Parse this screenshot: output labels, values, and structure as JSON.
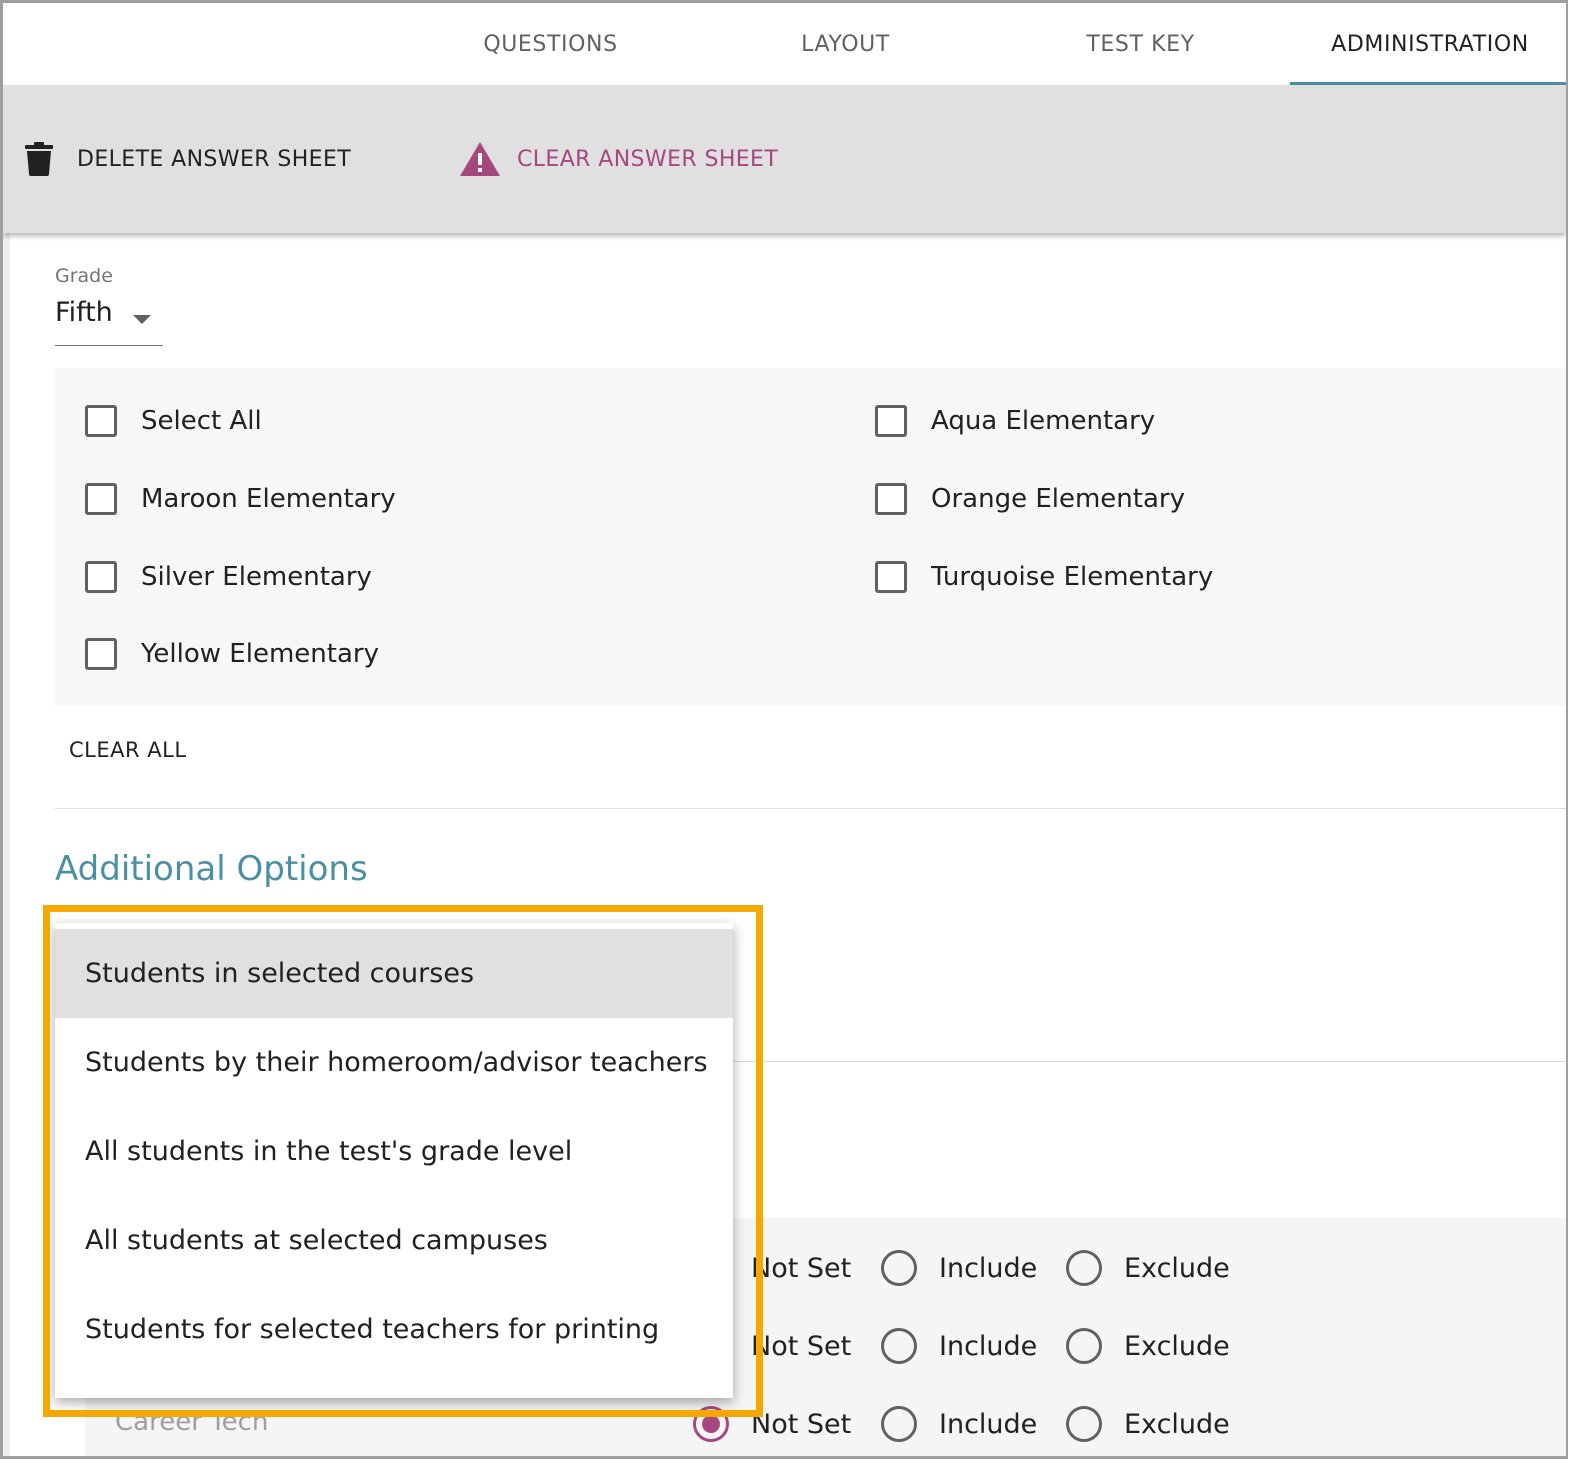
{
  "tabs": [
    "QUESTIONS",
    "LAYOUT",
    "TEST KEY",
    "ADMINISTRATION"
  ],
  "active_tab": "ADMINISTRATION",
  "toolbar": {
    "delete_label": "DELETE ANSWER SHEET",
    "clear_label": "CLEAR ANSWER SHEET",
    "warning_color": "#a64780"
  },
  "grade": {
    "label": "Grade",
    "value": "Fifth"
  },
  "campuses": [
    "Select All",
    "Aqua Elementary",
    "Maroon Elementary",
    "Orange Elementary",
    "Silver Elementary",
    "Turquoise Elementary",
    "Yellow Elementary"
  ],
  "clear_all_label": "CLEAR ALL",
  "additional_options_title": "Additional Options",
  "student_selection_menu": {
    "options": [
      "Students in selected courses",
      "Students by their homeroom/advisor teachers",
      "All students in the test's grade level",
      "All students at selected campuses",
      "Students for selected teachers for printing"
    ],
    "selected": "Students in selected courses"
  },
  "filters": {
    "rows": [
      {
        "label": "",
        "not_set": "Not Set",
        "include": "Include",
        "exclude": "Exclude"
      },
      {
        "label": "",
        "not_set": "Not Set",
        "include": "Include",
        "exclude": "Exclude"
      },
      {
        "label": "Career Tech",
        "not_set": "Not Set",
        "include": "Include",
        "exclude": "Exclude",
        "selected": "Not Set"
      }
    ]
  },
  "colors": {
    "accent": "#4a8fa3",
    "highlight": "#f5a800",
    "radio_selected": "#a64780"
  }
}
